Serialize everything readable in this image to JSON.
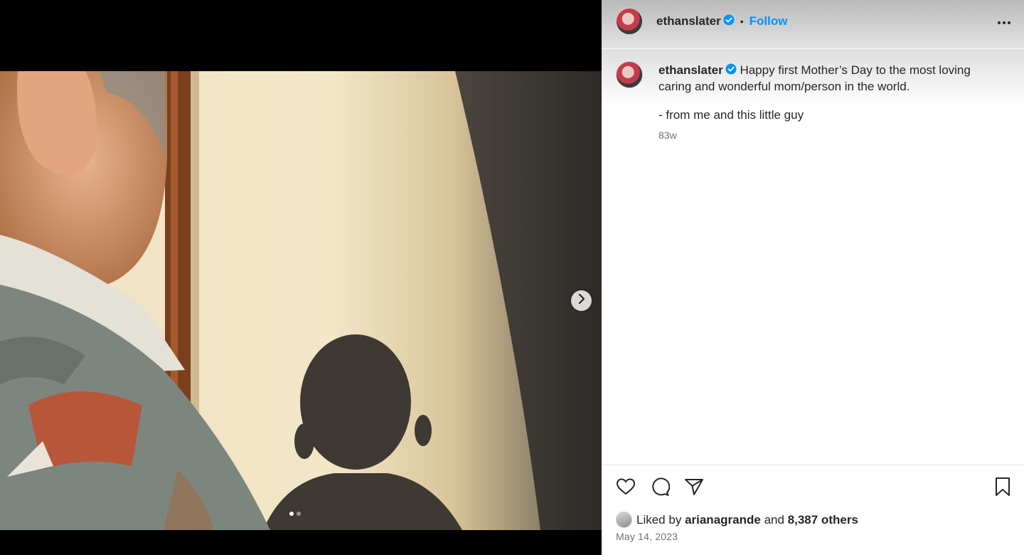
{
  "post": {
    "username": "ethanslater",
    "follow_label": "Follow",
    "separator": "•",
    "caption": "Happy first Mother’s Day to the most loving caring and wonderful mom/person in the world.",
    "caption_line2": "- from me and this little guy",
    "time_ago": "83w",
    "liked_prefix": "Liked by",
    "liked_user": "arianagrande",
    "liked_and": "and",
    "liked_others": "8,387 others",
    "date": "May 14, 2023"
  },
  "media": {
    "slide_count": 2,
    "active_slide": 1
  },
  "icons": {
    "verified": "verified-badge-icon",
    "more": "more-options-icon",
    "like": "heart-icon",
    "comment": "comment-icon",
    "share": "share-icon",
    "save": "bookmark-icon",
    "next": "chevron-right-icon"
  },
  "colors": {
    "follow": "#0095f6",
    "verified": "#0095f6",
    "muted_text": "#737373"
  }
}
